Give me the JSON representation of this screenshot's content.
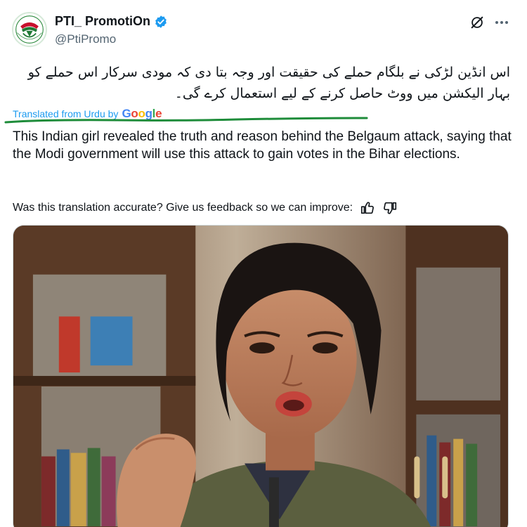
{
  "author": {
    "display_name": "PTI_ PromotiOn",
    "handle": "@PtiPromo",
    "verified": true,
    "avatar_icon": "pti-party-logo"
  },
  "header_actions": {
    "grok_icon": "grok-icon",
    "more_icon": "more-icon"
  },
  "post": {
    "original_text": "اس انڈین لڑکی نے بلگام حملے کی حقیقت اور وجہ بتا دی کہ مودی سرکار اس حملے کو بہار الیکشن میں ووٹ حاصل کرنے کے لیے استعمال کرے گی۔",
    "translated_from": "Translated from Urdu by",
    "translator_brand": "Google",
    "translation": "This Indian girl revealed the truth and reason behind the Belgaum attack, saying that the Modi government will use this attack to gain votes in the Bihar elections.",
    "feedback_prompt": "Was this translation accurate? Give us feedback so we can improve:",
    "accent_color": "#1d9bf0",
    "annotation_color": "#1e8c3a"
  },
  "media": {
    "type": "video",
    "description_icon": "video-thumbnail"
  }
}
